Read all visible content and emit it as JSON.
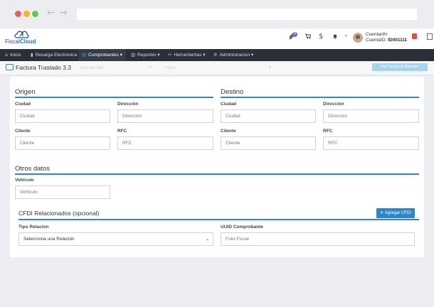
{
  "header": {
    "logo_text_plain": "Fiscal",
    "logo_text_bold": "Cloud",
    "notification_count": "0",
    "account_name": "Cuentanfrr",
    "account_id_label": "CuentaID:",
    "account_id": "ID001111",
    "account_caret": "▾"
  },
  "nav": {
    "items": [
      {
        "icon": "⌂",
        "label": "Inicio"
      },
      {
        "icon": "▮",
        "label": "Recarga Electronica"
      },
      {
        "icon": "▤",
        "label": "Comprobantes ▾"
      },
      {
        "icon": "▥",
        "label": "Reportes ▾"
      },
      {
        "icon": "✂",
        "label": "Herramientas ▾"
      },
      {
        "icon": "✣",
        "label": "Administracion ▾"
      }
    ]
  },
  "page": {
    "title": "Factura Traslado 3.3",
    "ghost_text_1": "Serie de Folio",
    "ghost_text_2": "Folios",
    "ghost_button": "Ver Factura en Borrador"
  },
  "origen": {
    "title": "Origen",
    "ciudad_label": "Ciudad",
    "ciudad_placeholder": "Ciudad",
    "direccion_label": "Dirección",
    "direccion_placeholder": "Dirección",
    "cliente_label": "Cliente",
    "cliente_placeholder": "Cliente",
    "rfc_label": "RFC",
    "rfc_placeholder": "RFC"
  },
  "destino": {
    "title": "Destino",
    "ciudad_label": "Ciudad",
    "ciudad_placeholder": "Ciudad",
    "direccion_label": "Dirección",
    "direccion_placeholder": "Dirección",
    "cliente_label": "Cliente",
    "cliente_placeholder": "Cliente",
    "rfc_label": "RFC",
    "rfc_placeholder": "RFC"
  },
  "otros": {
    "title": "Otros datos",
    "vehiculo_label": "Vehículo",
    "vehiculo_placeholder": "Vehículo"
  },
  "cfdi": {
    "title": "CFDI Relacionados (opcional)",
    "add_button": "Agregar CFDI",
    "tipo_label": "Tipo Relacion",
    "tipo_value": "Selecciona una Relación",
    "uuid_label": "UUID Comprobante",
    "uuid_placeholder": "Folio Fiscal"
  },
  "colors": {
    "accent": "#2e86c8",
    "navbar": "#2b3038",
    "danger": "#e74c3c"
  }
}
